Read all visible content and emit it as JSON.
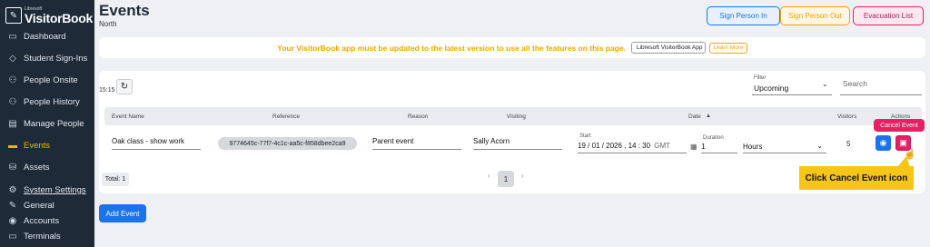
{
  "app": {
    "logo_small": "Libresoft",
    "logo_big": "VisitorBook"
  },
  "sidebar": {
    "items": [
      {
        "label": "Dashboard",
        "icon": "dashboard-icon"
      },
      {
        "label": "Student Sign-Ins",
        "icon": "graduation-icon"
      },
      {
        "label": "People Onsite",
        "icon": "people-icon"
      },
      {
        "label": "People History",
        "icon": "history-icon"
      },
      {
        "label": "Manage People",
        "icon": "id-card-icon"
      },
      {
        "label": "Events",
        "icon": "folder-icon"
      },
      {
        "label": "Assets",
        "icon": "assets-icon"
      },
      {
        "label": "System Settings",
        "icon": "settings-icon"
      },
      {
        "label": "General",
        "icon": "edit-icon"
      },
      {
        "label": "Accounts",
        "icon": "account-icon"
      },
      {
        "label": "Terminals",
        "icon": "terminal-icon"
      }
    ]
  },
  "header": {
    "title": "Events",
    "subtitle": "North",
    "buttons": {
      "sign_in": "Sign Person In",
      "sign_out": "Sign Person Out",
      "evac": "Evacuation List"
    }
  },
  "banner": {
    "text": "Your VisitorBook app must be updated to the latest version to use all the features on this page.",
    "chip": "Libresoft VisitorBook App",
    "learn": "Learn More"
  },
  "toolbar": {
    "time": "15:15",
    "filter_label": "Filter",
    "filter_value": "Upcoming",
    "search_placeholder": "Search"
  },
  "table": {
    "headers": {
      "name": "Event Name",
      "reference": "Reference",
      "reason": "Reason",
      "visiting": "Visiting",
      "date": "Date",
      "sort_icon": "▲",
      "visitors": "Visitors",
      "actions": "Actions"
    },
    "row": {
      "name": "Oak class - show work",
      "reference": "9774645c-77f7-4c1c-aa5c-f858dbee2ca9",
      "reason": "Parent event",
      "visiting": "Sally Acorn",
      "start_label": "Start",
      "start_value": "19 / 01 / 2026 , 14 : 30",
      "tz": "GMT",
      "duration_label": "Duration",
      "duration_value": "1",
      "duration_unit": "Hours",
      "visitors": "5"
    }
  },
  "tooltip": "Cancel Event",
  "footer": {
    "total": "Total: 1",
    "page": "1",
    "prev": "‹",
    "next": "›"
  },
  "callout": "Click Cancel Event icon",
  "add_button": "Add Event"
}
